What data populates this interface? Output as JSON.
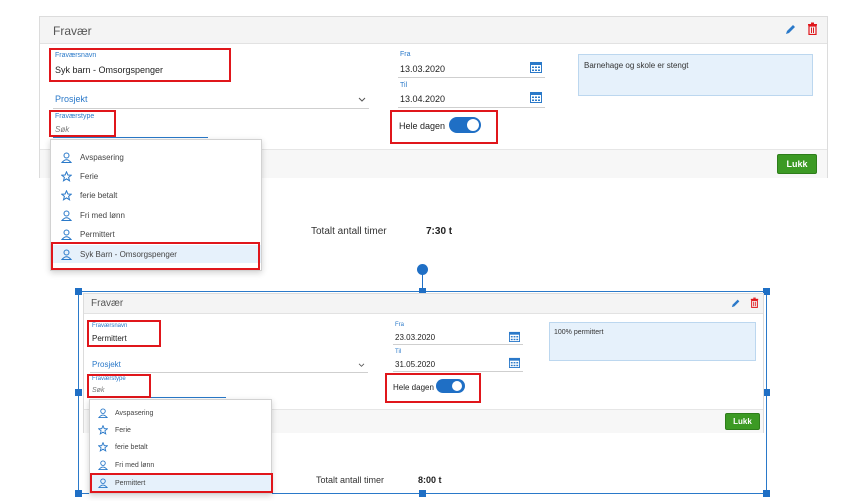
{
  "colors": {
    "accent": "#2a79c9",
    "toggle_on": "#1f6fc5",
    "button_green": "#3c9a24",
    "highlight_red": "#e0161b",
    "note_bg": "#e6f1fb",
    "delete_icon": "#e0161b"
  },
  "icons": {
    "edit": "pencil-icon",
    "delete": "trash-icon",
    "calendar": "calendar-icon",
    "dropdown": "chevron-down-icon",
    "person": "person-icon",
    "star": "star-icon"
  },
  "top": {
    "title": "Fravær",
    "name_label": "Fraværsnavn",
    "name_value": "Syk barn - Omsorgspenger",
    "project_label": "Prosjekt",
    "type_label": "Fraværstype",
    "type_placeholder": "Søk",
    "from_label": "Fra",
    "from_value": "13.03.2020",
    "to_label": "Til",
    "to_value": "13.04.2020",
    "allday_label": "Hele dagen",
    "allday_on": true,
    "note": "Barnehage og skole er stengt",
    "close_button": "Lukk",
    "dropdown_items": [
      {
        "label": "Avspasering",
        "icon": "person-icon"
      },
      {
        "label": "Ferie",
        "icon": "star-icon"
      },
      {
        "label": "ferie betalt",
        "icon": "star-icon"
      },
      {
        "label": "Fri med lønn",
        "icon": "person-icon"
      },
      {
        "label": "Permittert",
        "icon": "person-icon"
      },
      {
        "label": "Syk Barn - Omsorgspenger",
        "icon": "person-icon",
        "selected": true
      }
    ],
    "total_label": "Totalt antall timer",
    "total_value": "7:30 t"
  },
  "bottom": {
    "title": "Fravær",
    "name_label": "Fraværsnavn",
    "name_value": "Permittert",
    "project_label": "Prosjekt",
    "type_label": "Fraværstype",
    "type_placeholder": "Søk",
    "from_label": "Fra",
    "from_value": "23.03.2020",
    "to_label": "Til",
    "to_value": "31.05.2020",
    "allday_label": "Hele dagen",
    "allday_on": true,
    "note": "100% permittert",
    "close_button": "Lukk",
    "dropdown_items": [
      {
        "label": "Avspasering",
        "icon": "person-icon"
      },
      {
        "label": "Ferie",
        "icon": "star-icon"
      },
      {
        "label": "ferie betalt",
        "icon": "star-icon"
      },
      {
        "label": "Fri med lønn",
        "icon": "person-icon"
      },
      {
        "label": "Permittert",
        "icon": "person-icon",
        "selected": true
      }
    ],
    "total_label": "Totalt antall timer",
    "total_value": "8:00 t"
  }
}
